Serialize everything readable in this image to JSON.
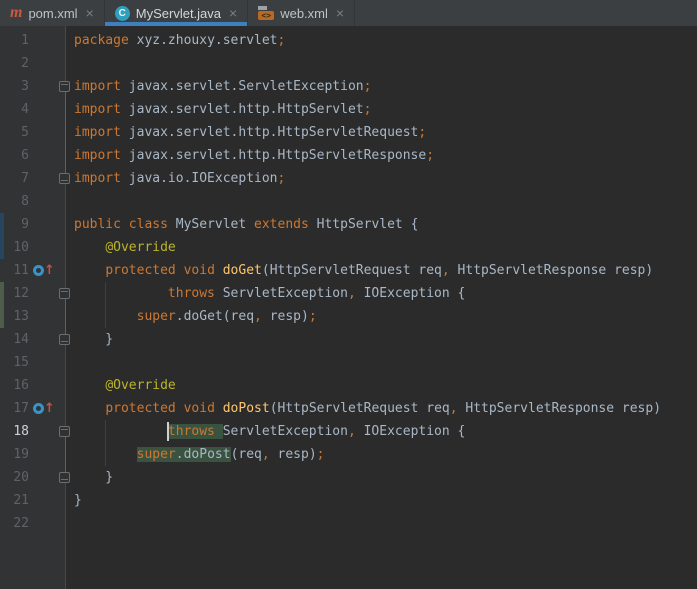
{
  "tabs": [
    {
      "label": "pom.xml",
      "icon": "maven-icon",
      "icon_glyph": "m",
      "close": "×",
      "selected": false
    },
    {
      "label": "MyServlet.java",
      "icon": "java-class-icon",
      "icon_glyph": "C",
      "close": "×",
      "selected": true
    },
    {
      "label": "web.xml",
      "icon": "xml-file-icon",
      "icon_glyph": "<>",
      "close": "×",
      "selected": false
    }
  ],
  "colors": {
    "tabbar_bg": "#3C3F41",
    "selected_tab_underline": "#3E80BE",
    "editor_bg": "#2B2B2B",
    "gutter_bg": "#313335",
    "keyword": "#CC7832",
    "plain_text": "#A9B7C6",
    "annotation": "#BBB529",
    "method_declaration": "#FFC66D",
    "highlight_bg": "#3A5340",
    "vcs_modified": "#27455F",
    "vcs_added": "#4E5C49",
    "line_number": "#606366",
    "current_line_number": "#CED2D6"
  },
  "editor": {
    "current_line": 18,
    "caret": {
      "line": 18,
      "col": 12
    },
    "override_lines": [
      11,
      17
    ],
    "fold_regions": [
      {
        "from": 3,
        "to": 7
      },
      {
        "from": 12,
        "to": 14
      },
      {
        "from": 18,
        "to": 20
      }
    ],
    "indent_guides": [
      {
        "col": 4,
        "from": 12,
        "to": 13
      },
      {
        "col": 4,
        "from": 18,
        "to": 19
      }
    ],
    "vcs_markers": [
      {
        "type": "modified",
        "from": 9,
        "to": 10,
        "color": "#27455F"
      },
      {
        "type": "added",
        "from": 12,
        "to": 13,
        "color": "#4E5C49"
      }
    ],
    "lines": [
      {
        "n": 1,
        "tokens": [
          [
            "kw",
            "package"
          ],
          [
            "pl",
            " xyz.zhouxy.servlet"
          ],
          [
            "pu",
            ";"
          ]
        ]
      },
      {
        "n": 2,
        "tokens": []
      },
      {
        "n": 3,
        "tokens": [
          [
            "kw",
            "import"
          ],
          [
            "pl",
            " javax.servlet.ServletException"
          ],
          [
            "pu",
            ";"
          ]
        ]
      },
      {
        "n": 4,
        "tokens": [
          [
            "kw",
            "import"
          ],
          [
            "pl",
            " javax.servlet.http.HttpServlet"
          ],
          [
            "pu",
            ";"
          ]
        ]
      },
      {
        "n": 5,
        "tokens": [
          [
            "kw",
            "import"
          ],
          [
            "pl",
            " javax.servlet.http.HttpServletRequest"
          ],
          [
            "pu",
            ";"
          ]
        ]
      },
      {
        "n": 6,
        "tokens": [
          [
            "kw",
            "import"
          ],
          [
            "pl",
            " javax.servlet.http.HttpServletResponse"
          ],
          [
            "pu",
            ";"
          ]
        ]
      },
      {
        "n": 7,
        "tokens": [
          [
            "kw",
            "import"
          ],
          [
            "pl",
            " java.io.IOException"
          ],
          [
            "pu",
            ";"
          ]
        ]
      },
      {
        "n": 8,
        "tokens": []
      },
      {
        "n": 9,
        "tokens": [
          [
            "kw",
            "public"
          ],
          [
            "pl",
            " "
          ],
          [
            "kw",
            "class"
          ],
          [
            "pl",
            " MyServlet "
          ],
          [
            "kw",
            "extends"
          ],
          [
            "pl",
            " HttpServlet {"
          ]
        ]
      },
      {
        "n": 10,
        "tokens": [
          [
            "pl",
            "    "
          ],
          [
            "ann",
            "@Override"
          ]
        ]
      },
      {
        "n": 11,
        "tokens": [
          [
            "pl",
            "    "
          ],
          [
            "kw",
            "protected"
          ],
          [
            "pl",
            " "
          ],
          [
            "kw",
            "void"
          ],
          [
            "pl",
            " "
          ],
          [
            "m",
            "doGet"
          ],
          [
            "pl",
            "(HttpServletRequest req"
          ],
          [
            "pu",
            ","
          ],
          [
            "pl",
            " HttpServletResponse resp)"
          ]
        ]
      },
      {
        "n": 12,
        "tokens": [
          [
            "pl",
            "            "
          ],
          [
            "kw",
            "throws"
          ],
          [
            "pl",
            " ServletException"
          ],
          [
            "pu",
            ","
          ],
          [
            "pl",
            " IOException {"
          ]
        ]
      },
      {
        "n": 13,
        "tokens": [
          [
            "pl",
            "        "
          ],
          [
            "kw",
            "super"
          ],
          [
            "pl",
            ".doGet(req"
          ],
          [
            "pu",
            ","
          ],
          [
            "pl",
            " resp)"
          ],
          [
            "pu",
            ";"
          ]
        ]
      },
      {
        "n": 14,
        "tokens": [
          [
            "pl",
            "    }"
          ]
        ]
      },
      {
        "n": 15,
        "tokens": []
      },
      {
        "n": 16,
        "tokens": [
          [
            "pl",
            "    "
          ],
          [
            "ann",
            "@Override"
          ]
        ]
      },
      {
        "n": 17,
        "tokens": [
          [
            "pl",
            "    "
          ],
          [
            "kw",
            "protected"
          ],
          [
            "pl",
            " "
          ],
          [
            "kw",
            "void"
          ],
          [
            "pl",
            " "
          ],
          [
            "m",
            "doPost"
          ],
          [
            "pl",
            "(HttpServletRequest req"
          ],
          [
            "pu",
            ","
          ],
          [
            "pl",
            " HttpServletResponse resp)"
          ]
        ]
      },
      {
        "n": 18,
        "tokens": [
          [
            "pl",
            "            "
          ],
          [
            "kw",
            "throws",
            "hl"
          ],
          [
            "pl",
            " ",
            "hl"
          ],
          [
            "pl",
            "ServletException"
          ],
          [
            "pu",
            ","
          ],
          [
            "pl",
            " IOException {"
          ]
        ]
      },
      {
        "n": 19,
        "tokens": [
          [
            "pl",
            "        "
          ],
          [
            "kw",
            "super",
            "hl"
          ],
          [
            "pl",
            ".doPost",
            "hl"
          ],
          [
            "pl",
            "(req"
          ],
          [
            "pu",
            ","
          ],
          [
            "pl",
            " resp)"
          ],
          [
            "pu",
            ";"
          ]
        ]
      },
      {
        "n": 20,
        "tokens": [
          [
            "pl",
            "    }"
          ]
        ]
      },
      {
        "n": 21,
        "tokens": [
          [
            "pl",
            "}"
          ]
        ]
      },
      {
        "n": 22,
        "tokens": []
      }
    ]
  }
}
